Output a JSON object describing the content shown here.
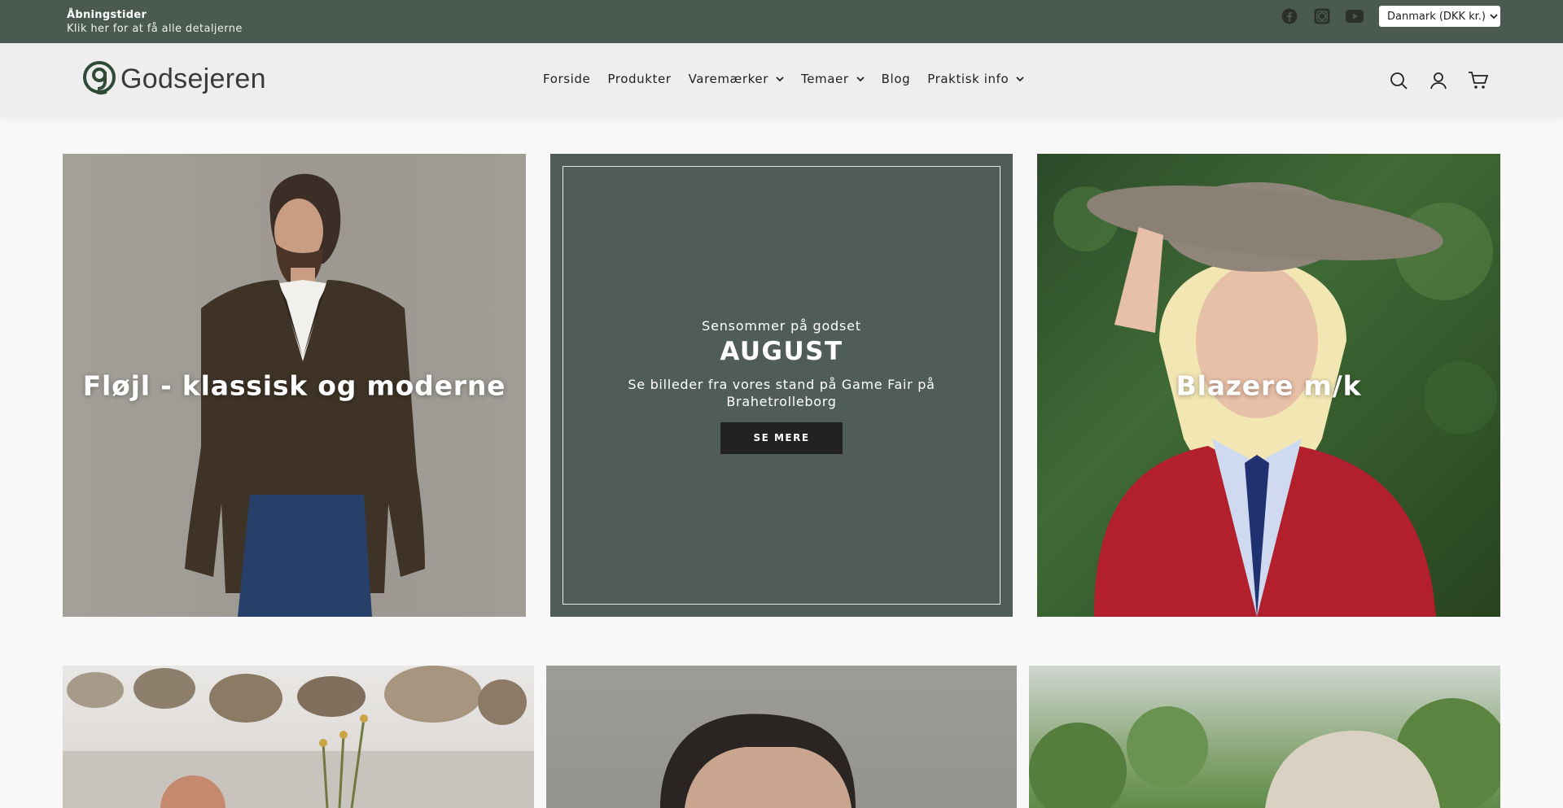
{
  "announcement": {
    "title": "Åbningstider",
    "subtitle": "Klik her for at få alle detaljerne"
  },
  "social": [
    {
      "icon": "facebook-icon"
    },
    {
      "icon": "instagram-icon"
    },
    {
      "icon": "youtube-icon"
    }
  ],
  "currency": {
    "selected": "Danmark (DKK kr.)"
  },
  "brand": {
    "name": "Godsejeren"
  },
  "nav": [
    {
      "label": "Forside",
      "dropdown": false
    },
    {
      "label": "Produkter",
      "dropdown": false
    },
    {
      "label": "Varemærker",
      "dropdown": true
    },
    {
      "label": "Temaer",
      "dropdown": true
    },
    {
      "label": "Blog",
      "dropdown": false
    },
    {
      "label": "Praktisk info",
      "dropdown": true
    }
  ],
  "header_icons": [
    "search-icon",
    "account-icon",
    "cart-icon"
  ],
  "tiles_row1": {
    "left": {
      "title": "Fløjl - klassisk og moderne"
    },
    "feature": {
      "kicker": "Sensommer på godset",
      "headline": "AUGUST",
      "description": "Se billeder fra vores stand på Game Fair på Brahetrolleborg",
      "button": "SE MERE"
    },
    "right": {
      "title": "Blazere m/k"
    }
  },
  "colors": {
    "topbar": "#4b5a50",
    "header": "#eeeeee",
    "feature_bg": "#505c56",
    "button": "#222222",
    "logo_green": "#2f4a36"
  }
}
